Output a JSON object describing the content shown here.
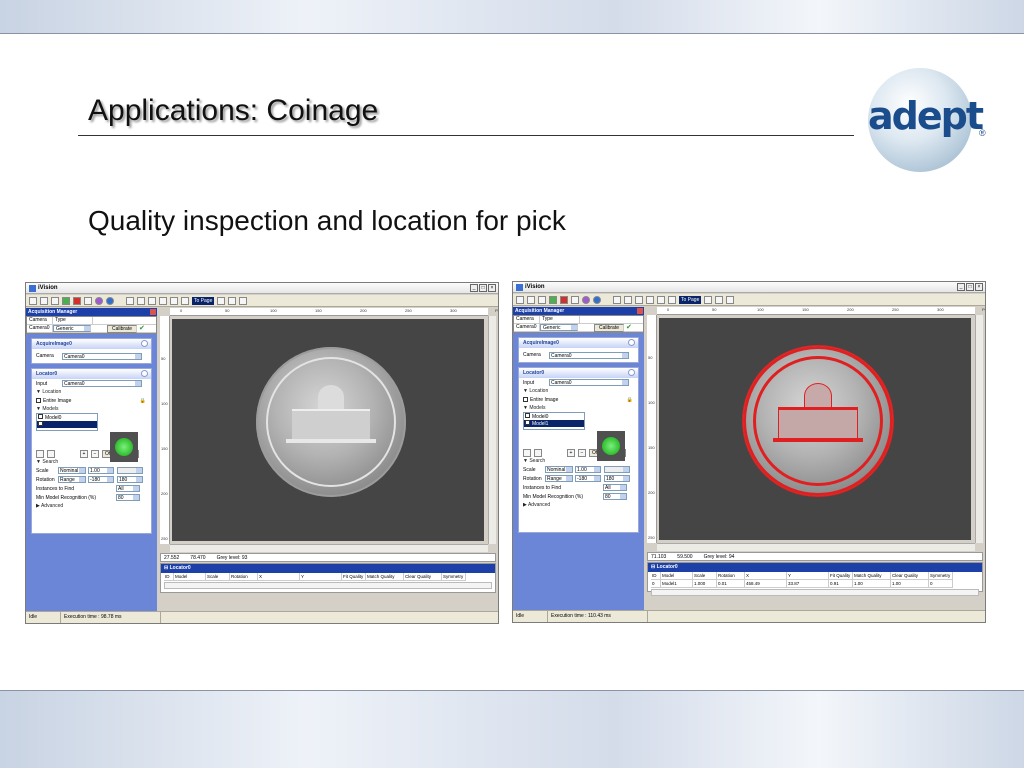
{
  "slide": {
    "title": "Applications: Coinage",
    "subtitle": "Quality inspection and location for pick",
    "logo_text": "adept",
    "logo_mark": "®"
  },
  "screens": [
    {
      "app_title": "iVision",
      "acq": {
        "title": "Acquisition Manager",
        "col_camera": "Camera",
        "col_type": "Type",
        "camera": "Camera0",
        "type": "Generic",
        "calibrate": "Calibrate"
      },
      "acquire": {
        "title": "AcquireImage0",
        "camera_label": "Camera",
        "camera_value": "Camera0"
      },
      "locator": {
        "title": "Locator0",
        "input_label": "Input",
        "input_value": "Camera0",
        "location_label": "Location",
        "entire_image": "Entire Image",
        "models_label": "Models",
        "model_items": [
          "Model0",
          ""
        ],
        "offset": "Offset",
        "edit": "Edit",
        "search_label": "Search",
        "scale_label": "Scale",
        "scale_mode": "Nominal",
        "scale_value": "1.00",
        "rotation_label": "Rotation",
        "rotation_mode": "Range",
        "rot_min": "-180",
        "rot_max": "180",
        "instances_label": "Instances to Find",
        "instances_value": "All",
        "minmodel_label": "Min Model Recognition (%)",
        "minmodel_value": "80",
        "advanced_label": "Advanced"
      },
      "zoom": "To Page",
      "ruler_top": [
        "0",
        "50",
        "100",
        "150",
        "200",
        "250",
        "300",
        "Pixel"
      ],
      "ruler_left": [
        "50",
        "100",
        "150",
        "200",
        "250"
      ],
      "info": {
        "x": "27.552",
        "y": "78.470",
        "grey": "Grey level: 93"
      },
      "results_title": "Locator0",
      "columns": [
        "ID",
        "Model",
        "Scale",
        "Rotation",
        "X",
        "Y",
        "Fit Quality",
        "Match Quality",
        "Clear Quality",
        "Symmetry"
      ],
      "rows": [],
      "status": {
        "state": "Idle",
        "exec": "Execution time : 98.78 ms"
      }
    },
    {
      "app_title": "iVision",
      "acq": {
        "title": "Acquisition Manager",
        "col_camera": "Camera",
        "col_type": "Type",
        "camera": "Camera0",
        "type": "Generic",
        "calibrate": "Calibrate"
      },
      "acquire": {
        "title": "AcquireImage0",
        "camera_label": "Camera",
        "camera_value": "Camera0"
      },
      "locator": {
        "title": "Locator0",
        "input_label": "Input",
        "input_value": "Camera0",
        "location_label": "Location",
        "entire_image": "Entire Image",
        "models_label": "Models",
        "model_items": [
          "Model0",
          "Model1"
        ],
        "offset": "Offset",
        "edit": "Edit",
        "search_label": "Search",
        "scale_label": "Scale",
        "scale_mode": "Nominal",
        "scale_value": "1.00",
        "rotation_label": "Rotation",
        "rotation_mode": "Range",
        "rot_min": "-180",
        "rot_max": "180",
        "instances_label": "Instances to Find",
        "instances_value": "All",
        "minmodel_label": "Min Model Recognition (%)",
        "minmodel_value": "80",
        "advanced_label": "Advanced"
      },
      "zoom": "To Page",
      "ruler_top": [
        "0",
        "50",
        "100",
        "150",
        "200",
        "250",
        "300",
        "Pixel"
      ],
      "ruler_left": [
        "50",
        "100",
        "150",
        "200",
        "250"
      ],
      "info": {
        "x": "71.103",
        "y": "59.500",
        "grey": "Grey level: 94"
      },
      "results_title": "Locator0",
      "columns": [
        "ID",
        "Model",
        "Scale",
        "Rotation",
        "X",
        "Y",
        "Fit Quality",
        "Match Quality",
        "Clear Quality",
        "Symmetry"
      ],
      "rows": [
        [
          "0",
          "Model1",
          "1.000",
          "0.01",
          "458.49",
          "33.87",
          "0.91",
          "1.00",
          "1.00",
          "0"
        ]
      ],
      "status": {
        "state": "Idle",
        "exec": "Execution time : 110.43 ms"
      }
    }
  ]
}
